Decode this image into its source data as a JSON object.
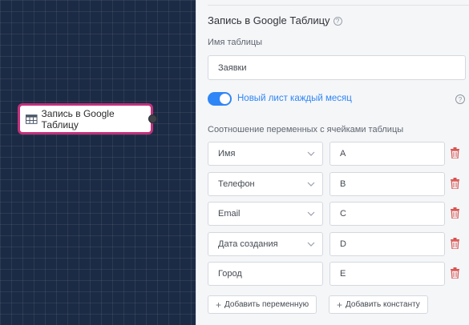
{
  "canvas": {
    "node": {
      "label": "Запись в Google Таблицу",
      "icon": "table-icon",
      "border_color": "#c2307c"
    }
  },
  "panel": {
    "title": "Запись в Google Таблицу",
    "help_glyph": "?",
    "sheet_name_label": "Имя таблицы",
    "sheet_name_value": "Заявки",
    "toggle_label": "Новый лист каждый месяц",
    "toggle_on": true,
    "accent_color": "#2f86f6",
    "mapping_label": "Соотношение переменных с ячейками таблицы",
    "mappings": [
      {
        "variable": "Имя",
        "column": "A"
      },
      {
        "variable": "Телефон",
        "column": "B"
      },
      {
        "variable": "Email",
        "column": "C"
      },
      {
        "variable": "Дата создания",
        "column": "D"
      },
      {
        "variable": "Город",
        "column": "E"
      }
    ],
    "add_variable_label": "Добавить переменную",
    "add_constant_label": "Добавить константу",
    "plus_glyph": "+",
    "delete_color": "#d9534f"
  }
}
